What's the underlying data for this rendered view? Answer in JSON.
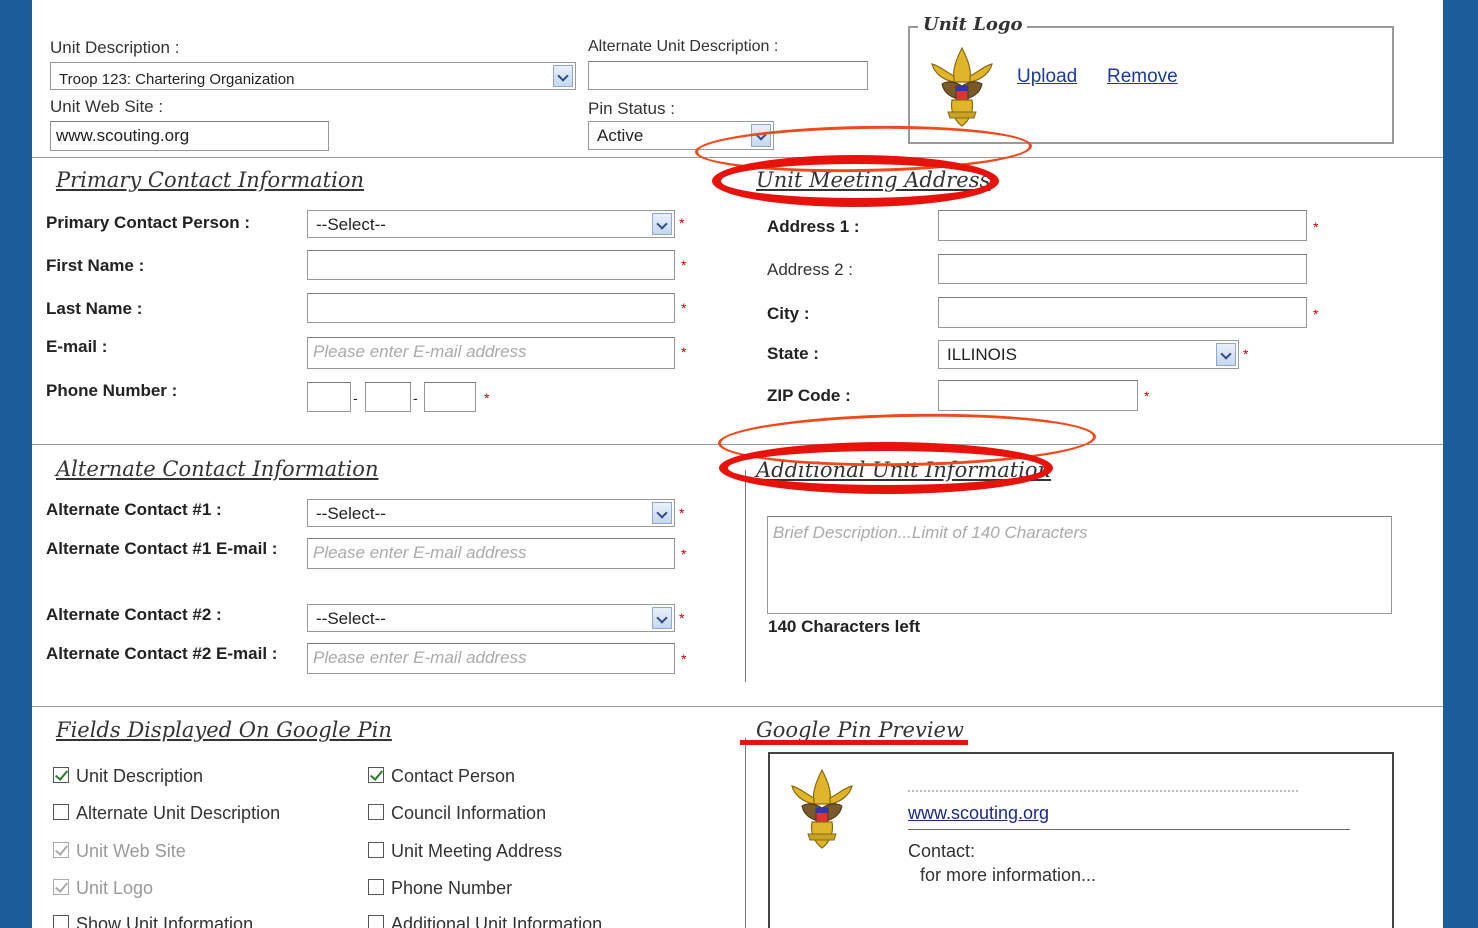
{
  "unit": {
    "description_label": "Unit Description :",
    "description_value": "Troop 123: Chartering Organization",
    "alt_description_label": "Alternate Unit Description :",
    "alt_description_value": "",
    "website_label": "Unit Web Site :",
    "website_value": "www.scouting.org",
    "pin_status_label": "Pin Status :",
    "pin_status_value": "Active",
    "logo_title": "Unit Logo",
    "upload_label": "Upload",
    "remove_label": "Remove"
  },
  "primary": {
    "title": "Primary Contact Information",
    "person_label": "Primary Contact Person :",
    "person_value": "--Select--",
    "first_label": "First Name :",
    "last_label": "Last Name :",
    "email_label": "E-mail :",
    "email_placeholder": "Please enter E-mail address",
    "phone_label": "Phone Number :",
    "phone_sep": "-"
  },
  "meeting": {
    "title": "Unit Meeting Address",
    "addr1_label": "Address 1 :",
    "addr2_label": "Address 2 :",
    "city_label": "City :",
    "state_label": "State :",
    "state_value": "ILLINOIS",
    "zip_label": "ZIP Code :"
  },
  "alternate": {
    "title": "Alternate Contact Information",
    "c1_label": "Alternate Contact #1 :",
    "c1_value": "--Select--",
    "c1_email_label": "Alternate Contact #1 E-mail :",
    "c1_email_placeholder": "Please enter E-mail address",
    "c2_label": "Alternate Contact #2 :",
    "c2_value": "--Select--",
    "c2_email_label": "Alternate Contact #2 E-mail :",
    "c2_email_placeholder": "Please enter E-mail address"
  },
  "additional": {
    "title": "Additional Unit Information",
    "placeholder": "Brief Description...Limit of 140 Characters",
    "chars_left": "140 Characters left"
  },
  "pin_fields": {
    "title": "Fields Displayed On Google Pin",
    "items": [
      {
        "label": "Unit Description",
        "checked": true,
        "disabled": false
      },
      {
        "label": "Alternate Unit Description",
        "checked": false,
        "disabled": false
      },
      {
        "label": "Unit Web Site",
        "checked": true,
        "disabled": true
      },
      {
        "label": "Unit Logo",
        "checked": true,
        "disabled": true
      },
      {
        "label": "Show Unit Information",
        "checked": false,
        "disabled": false
      },
      {
        "label": "Contact Person",
        "checked": true,
        "disabled": false
      },
      {
        "label": "Council Information",
        "checked": false,
        "disabled": false
      },
      {
        "label": "Unit Meeting Address",
        "checked": false,
        "disabled": false
      },
      {
        "label": "Phone Number",
        "checked": false,
        "disabled": false
      },
      {
        "label": "Additional Unit Information",
        "checked": false,
        "disabled": false
      }
    ]
  },
  "preview": {
    "title": "Google Pin Preview",
    "website": "www.scouting.org",
    "contact_label": "Contact:",
    "more_info": "for more information..."
  },
  "required_mark": "*",
  "colors": {
    "frame": "#1c5c9a",
    "annotation_red": "#e8120c",
    "annotation_orange": "#f04a1c",
    "link": "#1a3b9a",
    "required": "#cc0000"
  }
}
